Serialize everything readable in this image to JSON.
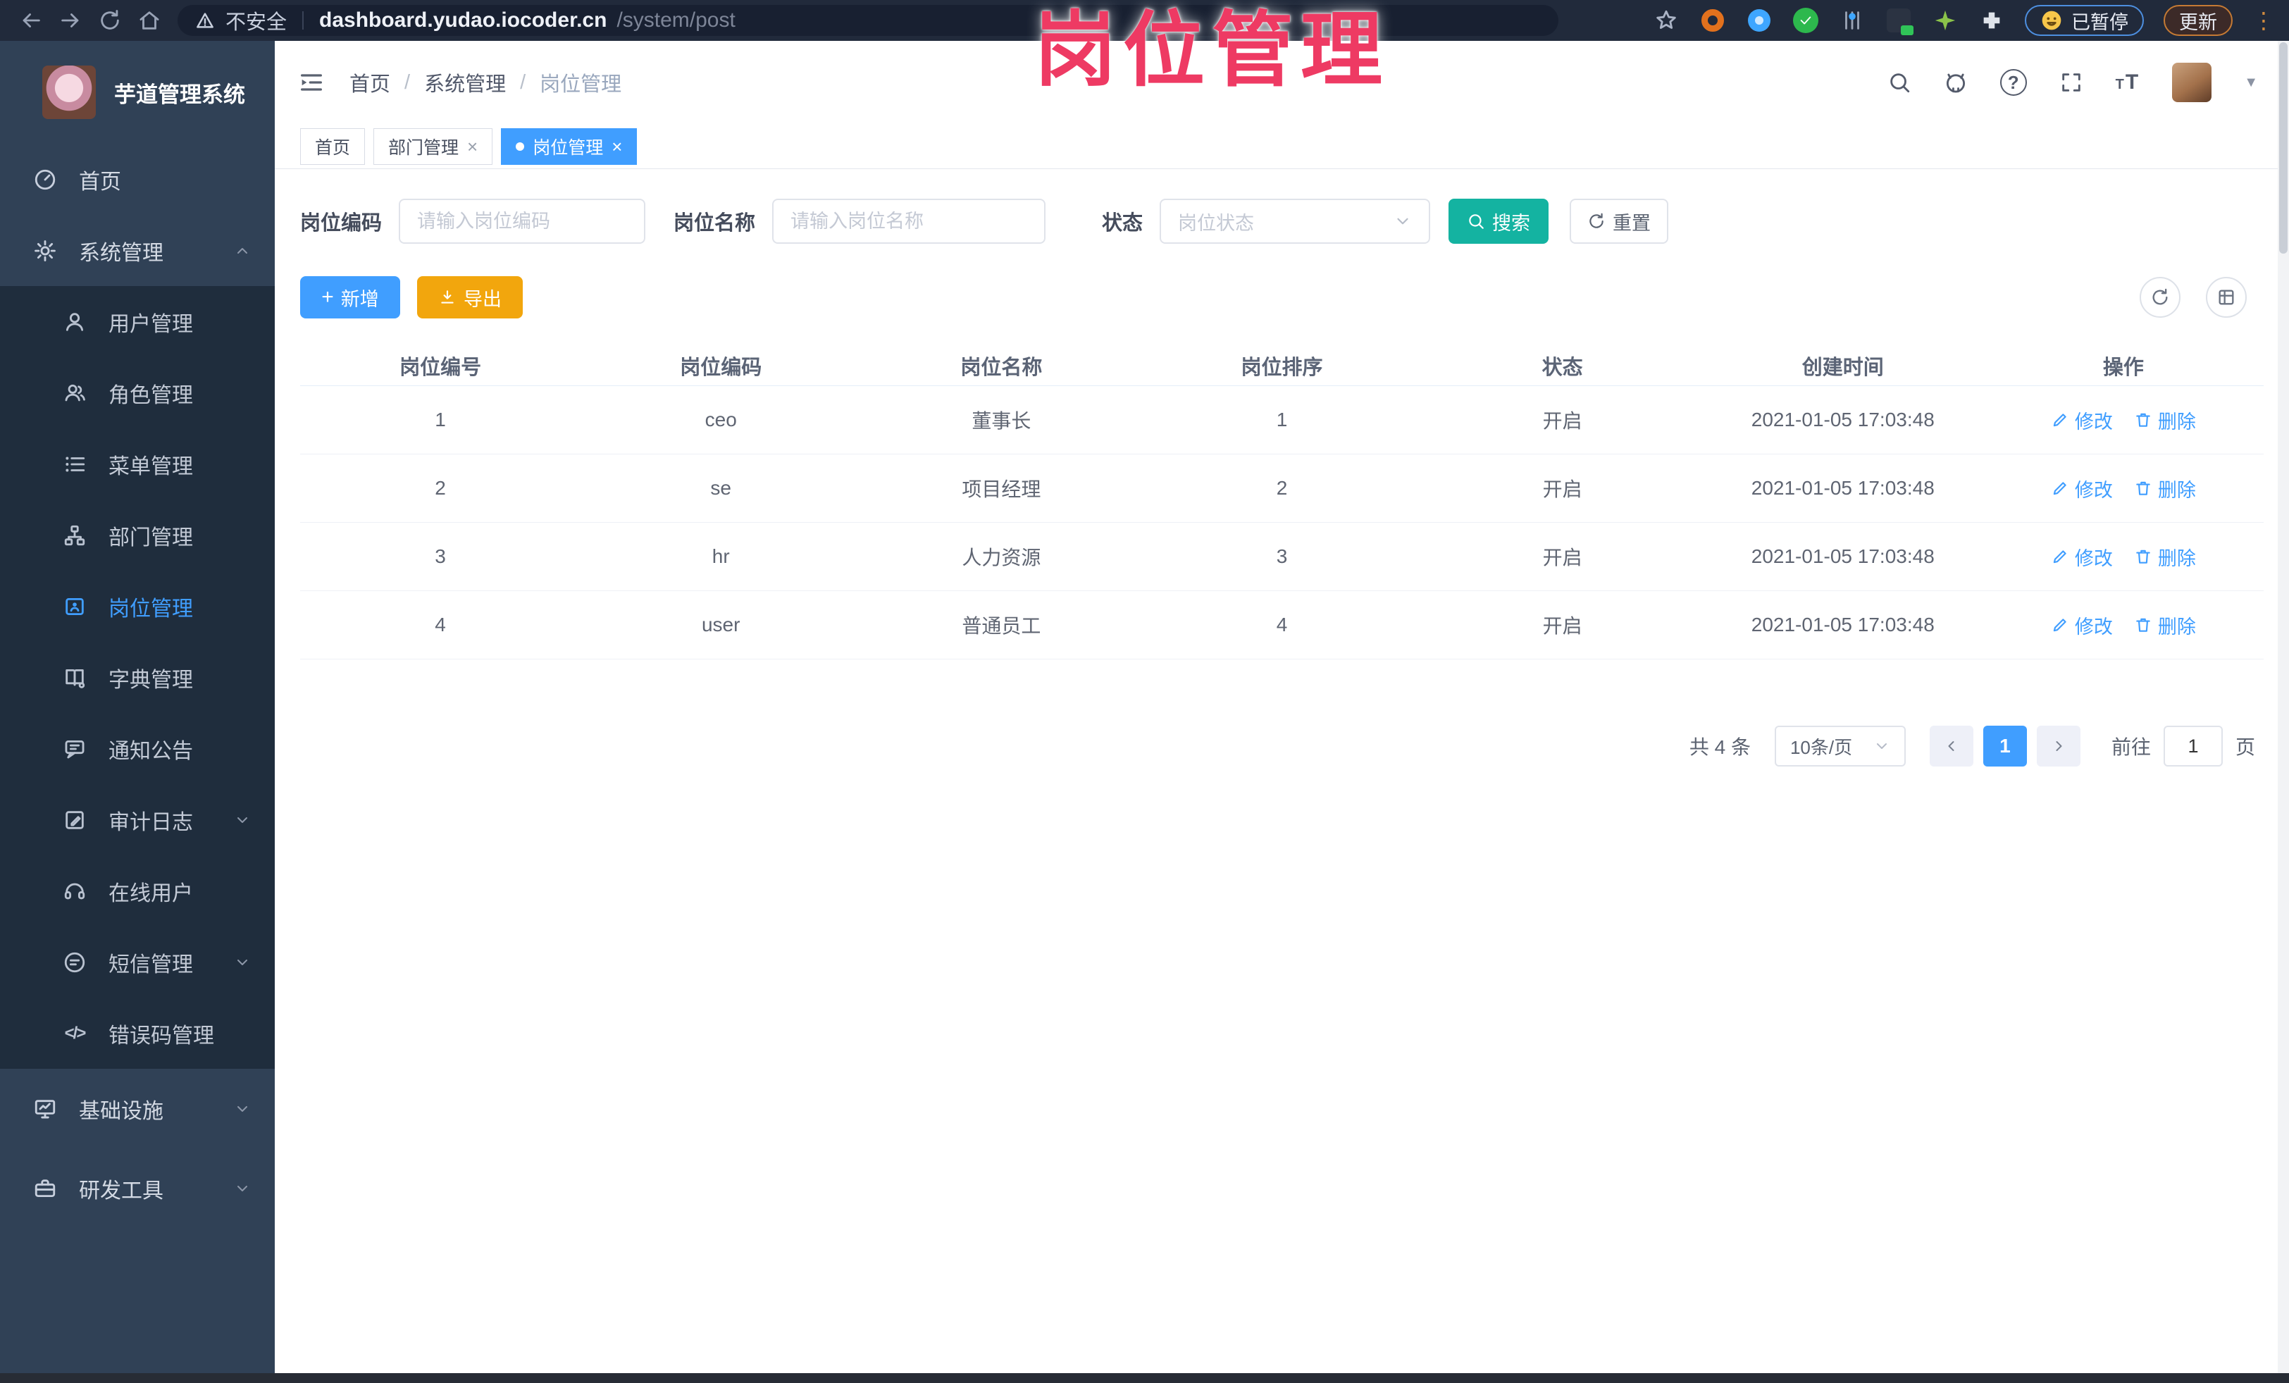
{
  "browser": {
    "security_label": "不安全",
    "url_host": "dashboard.yudao.iocoder.cn",
    "url_path": "/system/post",
    "paused_label": "已暂停",
    "update_label": "更新"
  },
  "overlay": {
    "title": "岗位管理"
  },
  "sidebar": {
    "app_title": "芋道管理系统",
    "home_label": "首页",
    "system_label": "系统管理",
    "submenu": [
      {
        "label": "用户管理"
      },
      {
        "label": "角色管理"
      },
      {
        "label": "菜单管理"
      },
      {
        "label": "部门管理"
      },
      {
        "label": "岗位管理"
      },
      {
        "label": "字典管理"
      },
      {
        "label": "通知公告"
      },
      {
        "label": "审计日志"
      },
      {
        "label": "在线用户"
      },
      {
        "label": "短信管理"
      },
      {
        "label": "错误码管理"
      }
    ],
    "infra_label": "基础设施",
    "devtool_label": "研发工具"
  },
  "breadcrumb": {
    "items": [
      "首页",
      "系统管理",
      "岗位管理"
    ]
  },
  "tabs": [
    {
      "label": "首页"
    },
    {
      "label": "部门管理"
    },
    {
      "label": "岗位管理"
    }
  ],
  "filters": {
    "code_label": "岗位编码",
    "code_placeholder": "请输入岗位编码",
    "name_label": "岗位名称",
    "name_placeholder": "请输入岗位名称",
    "status_label": "状态",
    "status_placeholder": "岗位状态",
    "search_label": "搜索",
    "reset_label": "重置"
  },
  "toolbar": {
    "add_label": "新增",
    "export_label": "导出"
  },
  "table": {
    "headers": [
      "岗位编号",
      "岗位编码",
      "岗位名称",
      "岗位排序",
      "状态",
      "创建时间",
      "操作"
    ],
    "edit_label": "修改",
    "delete_label": "删除",
    "rows": [
      {
        "id": "1",
        "code": "ceo",
        "name": "董事长",
        "sort": "1",
        "status": "开启",
        "created": "2021-01-05 17:03:48"
      },
      {
        "id": "2",
        "code": "se",
        "name": "项目经理",
        "sort": "2",
        "status": "开启",
        "created": "2021-01-05 17:03:48"
      },
      {
        "id": "3",
        "code": "hr",
        "name": "人力资源",
        "sort": "3",
        "status": "开启",
        "created": "2021-01-05 17:03:48"
      },
      {
        "id": "4",
        "code": "user",
        "name": "普通员工",
        "sort": "4",
        "status": "开启",
        "created": "2021-01-05 17:03:48"
      }
    ]
  },
  "pagination": {
    "total_label": "共 4 条",
    "page_size_label": "10条/页",
    "current_page": "1",
    "goto_label": "前往",
    "goto_value": "1",
    "goto_suffix": "页"
  },
  "colors": {
    "primary": "#409eff",
    "success": "#14b3a1",
    "warning": "#f2a60d",
    "overlay_pink": "#ee3a63"
  }
}
